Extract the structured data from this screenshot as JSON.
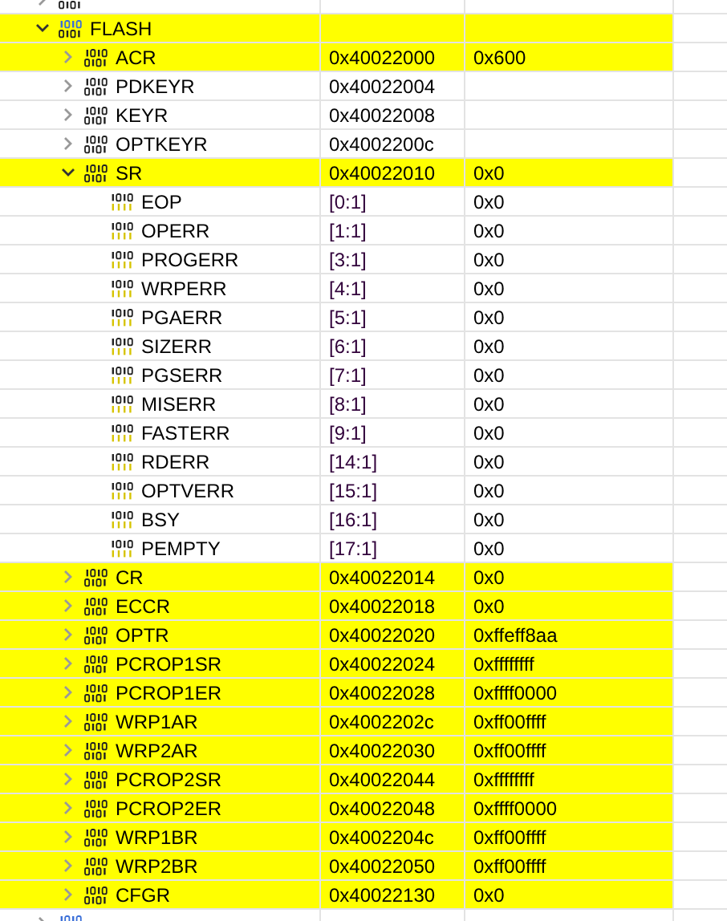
{
  "tree": [
    {
      "kind": "peripheral",
      "expanded": false,
      "changed": false
    },
    {
      "name": "FLASH",
      "kind": "peripheral",
      "expanded": true,
      "changed": true,
      "children": [
        {
          "name": "ACR",
          "kind": "register",
          "address": "0x40022000",
          "value": "0x600",
          "expanded": false,
          "changed": true
        },
        {
          "name": "PDKEYR",
          "kind": "register",
          "address": "0x40022004",
          "expanded": false,
          "changed": false
        },
        {
          "name": "KEYR",
          "kind": "register",
          "address": "0x40022008",
          "expanded": false,
          "changed": false
        },
        {
          "name": "OPTKEYR",
          "kind": "register",
          "address": "0x4002200c",
          "expanded": false,
          "changed": false
        },
        {
          "name": "SR",
          "kind": "register",
          "address": "0x40022010",
          "value": "0x0",
          "expanded": true,
          "changed": true,
          "children": [
            {
              "name": "EOP",
              "kind": "field",
              "address": "[0:1]",
              "value": "0x0",
              "changed": false
            },
            {
              "name": "OPERR",
              "kind": "field",
              "address": "[1:1]",
              "value": "0x0",
              "changed": false
            },
            {
              "name": "PROGERR",
              "kind": "field",
              "address": "[3:1]",
              "value": "0x0",
              "changed": false
            },
            {
              "name": "WRPERR",
              "kind": "field",
              "address": "[4:1]",
              "value": "0x0",
              "changed": false
            },
            {
              "name": "PGAERR",
              "kind": "field",
              "address": "[5:1]",
              "value": "0x0",
              "changed": false
            },
            {
              "name": "SIZERR",
              "kind": "field",
              "address": "[6:1]",
              "value": "0x0",
              "changed": false
            },
            {
              "name": "PGSERR",
              "kind": "field",
              "address": "[7:1]",
              "value": "0x0",
              "changed": false
            },
            {
              "name": "MISERR",
              "kind": "field",
              "address": "[8:1]",
              "value": "0x0",
              "changed": false
            },
            {
              "name": "FASTERR",
              "kind": "field",
              "address": "[9:1]",
              "value": "0x0",
              "changed": false
            },
            {
              "name": "RDERR",
              "kind": "field",
              "address": "[14:1]",
              "value": "0x0",
              "changed": false
            },
            {
              "name": "OPTVERR",
              "kind": "field",
              "address": "[15:1]",
              "value": "0x0",
              "changed": false
            },
            {
              "name": "BSY",
              "kind": "field",
              "address": "[16:1]",
              "value": "0x0",
              "changed": false
            },
            {
              "name": "PEMPTY",
              "kind": "field",
              "address": "[17:1]",
              "value": "0x0",
              "changed": false
            }
          ]
        },
        {
          "name": "CR",
          "kind": "register",
          "address": "0x40022014",
          "value": "0x0",
          "expanded": false,
          "changed": true
        },
        {
          "name": "ECCR",
          "kind": "register",
          "address": "0x40022018",
          "value": "0x0",
          "expanded": false,
          "changed": true
        },
        {
          "name": "OPTR",
          "kind": "register",
          "address": "0x40022020",
          "value": "0xffeff8aa",
          "expanded": false,
          "changed": true
        },
        {
          "name": "PCROP1SR",
          "kind": "register",
          "address": "0x40022024",
          "value": "0xffffffff",
          "expanded": false,
          "changed": true
        },
        {
          "name": "PCROP1ER",
          "kind": "register",
          "address": "0x40022028",
          "value": "0xffff0000",
          "expanded": false,
          "changed": true
        },
        {
          "name": "WRP1AR",
          "kind": "register",
          "address": "0x4002202c",
          "value": "0xff00ffff",
          "expanded": false,
          "changed": true
        },
        {
          "name": "WRP2AR",
          "kind": "register",
          "address": "0x40022030",
          "value": "0xff00ffff",
          "expanded": false,
          "changed": true
        },
        {
          "name": "PCROP2SR",
          "kind": "register",
          "address": "0x40022044",
          "value": "0xffffffff",
          "expanded": false,
          "changed": true
        },
        {
          "name": "PCROP2ER",
          "kind": "register",
          "address": "0x40022048",
          "value": "0xffff0000",
          "expanded": false,
          "changed": true
        },
        {
          "name": "WRP1BR",
          "kind": "register",
          "address": "0x4002204c",
          "value": "0xff00ffff",
          "expanded": false,
          "changed": true
        },
        {
          "name": "WRP2BR",
          "kind": "register",
          "address": "0x40022050",
          "value": "0xff00ffff",
          "expanded": false,
          "changed": true
        },
        {
          "name": "CFGR",
          "kind": "register",
          "address": "0x40022130",
          "value": "0x0",
          "expanded": false,
          "changed": true
        }
      ]
    },
    {
      "kind": "peripheral",
      "expanded": false,
      "changed": false
    }
  ]
}
